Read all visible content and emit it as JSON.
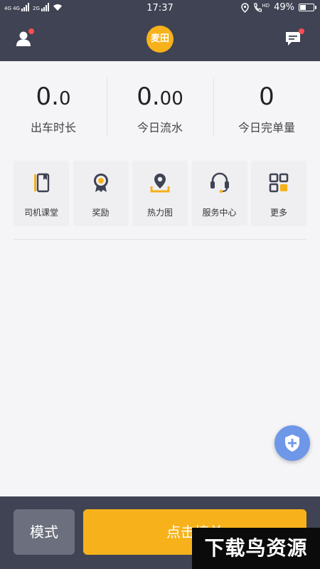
{
  "status_bar": {
    "network_1": "4G 4G",
    "network_2": "2G",
    "time": "17:37",
    "battery": "49%",
    "battery_level": 0.49,
    "hd_label": "HD"
  },
  "header": {
    "logo_text": "麦田",
    "user_icon": "user-icon",
    "message_icon": "message-icon",
    "accent": "#f7b21b",
    "bar_color": "#3f4353",
    "badge_color": "#ff4d4f"
  },
  "stats": [
    {
      "int": "0.",
      "dec": "0",
      "label": "出车时长"
    },
    {
      "int": "0.",
      "dec": "00",
      "label": "今日流水"
    },
    {
      "int": "0",
      "dec": "",
      "label": "今日完单量"
    }
  ],
  "menu": [
    {
      "label": "司机课堂",
      "icon": "book-icon"
    },
    {
      "label": "奖励",
      "icon": "medal-icon"
    },
    {
      "label": "热力图",
      "icon": "map-pin-icon"
    },
    {
      "label": "服务中心",
      "icon": "headset-icon"
    },
    {
      "label": "更多",
      "icon": "grid-icon"
    }
  ],
  "fab": {
    "icon": "shield-plus-icon",
    "color": "#6e97e8"
  },
  "bottom": {
    "mode_label": "模式",
    "accept_label": "点击接单"
  },
  "watermark": "下载鸟资源"
}
